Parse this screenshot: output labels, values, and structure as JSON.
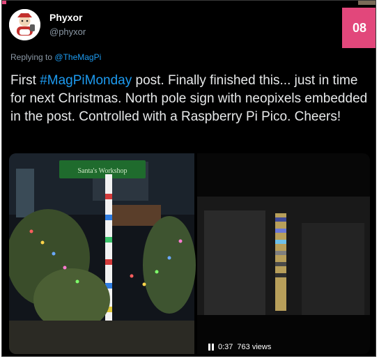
{
  "tweet": {
    "author_name": "Phyxor",
    "author_handle": "@phyxor",
    "replying_prefix": "Replying to",
    "replying_to": "@TheMagPi",
    "text_parts": {
      "p1": "First ",
      "hashtag": "#MagPiMonday",
      "p2": " post. Finally finished this... just in time for next Christmas. North pole sign with neopixels embedded in the post. Controlled with a Raspberry Pi Pico. Cheers!"
    },
    "media": {
      "sign_text": "Santa's Workshop"
    },
    "video": {
      "time": "0:37",
      "views": "763 views"
    }
  },
  "badge": {
    "label": "08"
  },
  "icons": {
    "avatar": "avatar-icon",
    "pause": "pause-icon"
  },
  "colors": {
    "accent": "#e2477b",
    "link": "#1d9bf0",
    "muted": "#8b98a5",
    "text": "#e7e9ea",
    "background": "#000000"
  }
}
